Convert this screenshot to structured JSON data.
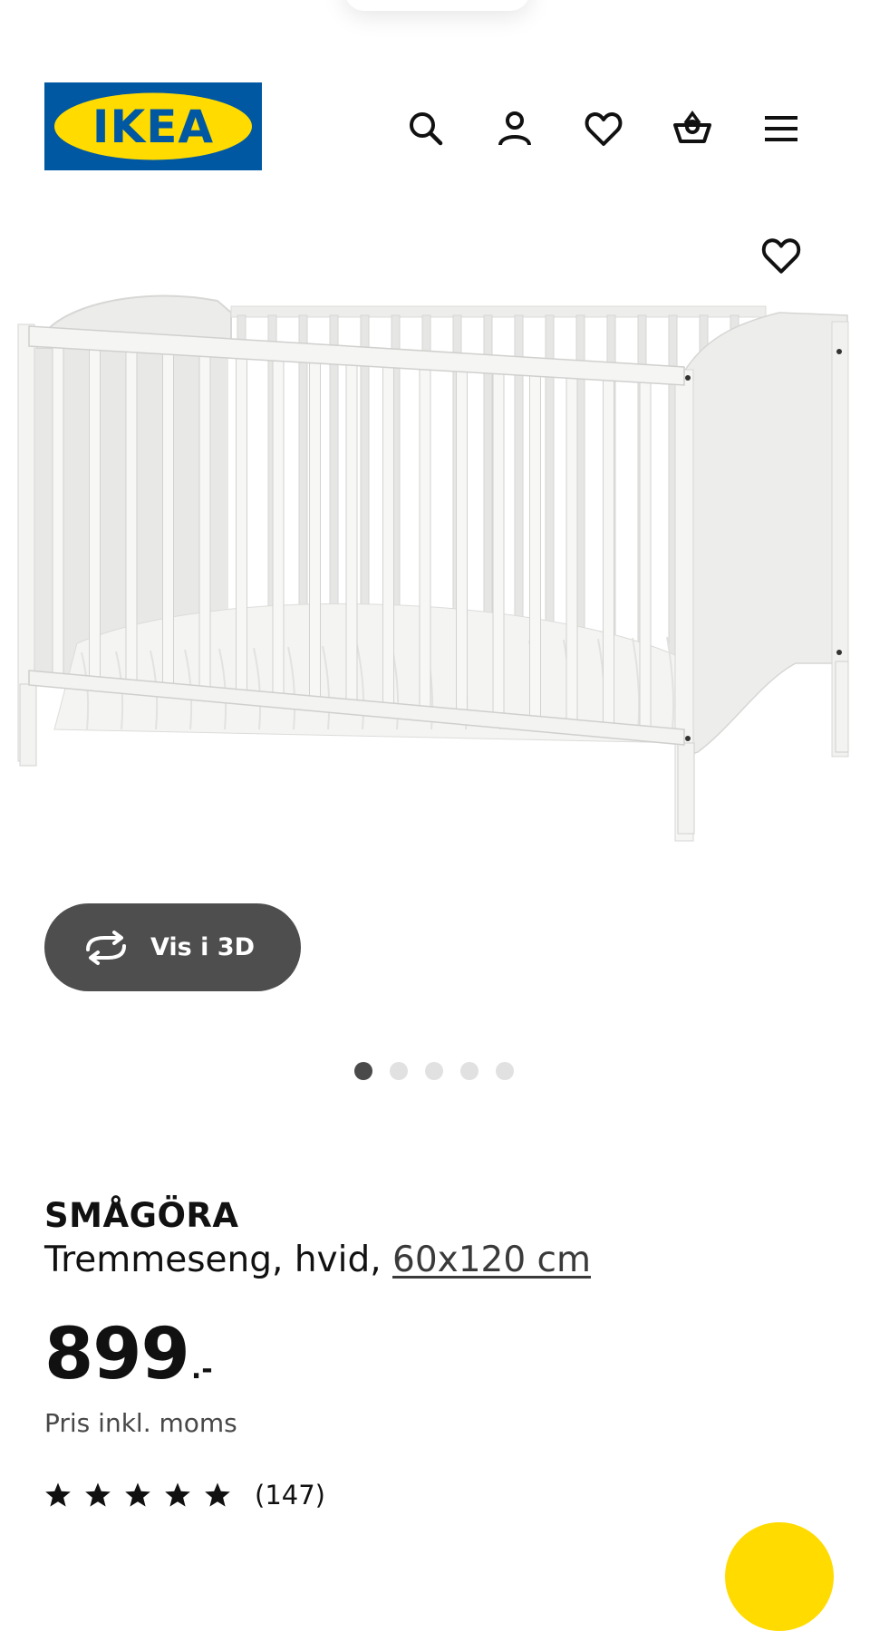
{
  "brand": {
    "logo_text": "IKEA",
    "colors": {
      "blue": "#0058a3",
      "yellow": "#ffdb00"
    }
  },
  "header": {
    "icons": [
      "search-icon",
      "account-icon",
      "favorites-icon",
      "cart-icon",
      "menu-icon"
    ]
  },
  "product": {
    "name": "SMÅGÖRA",
    "description_prefix": "Tremmeseng, hvid,",
    "size": "60x120 cm",
    "price_integer": "899",
    "price_decimal": ".-",
    "price_note": "Pris inkl. moms",
    "rating": {
      "stars": 5,
      "count": "(147)"
    },
    "image_icon": "crib-product-image"
  },
  "view3d": {
    "label": "Vis i 3D",
    "icon": "rotate-3d-icon"
  },
  "carousel": {
    "total": 5,
    "active": 1
  }
}
